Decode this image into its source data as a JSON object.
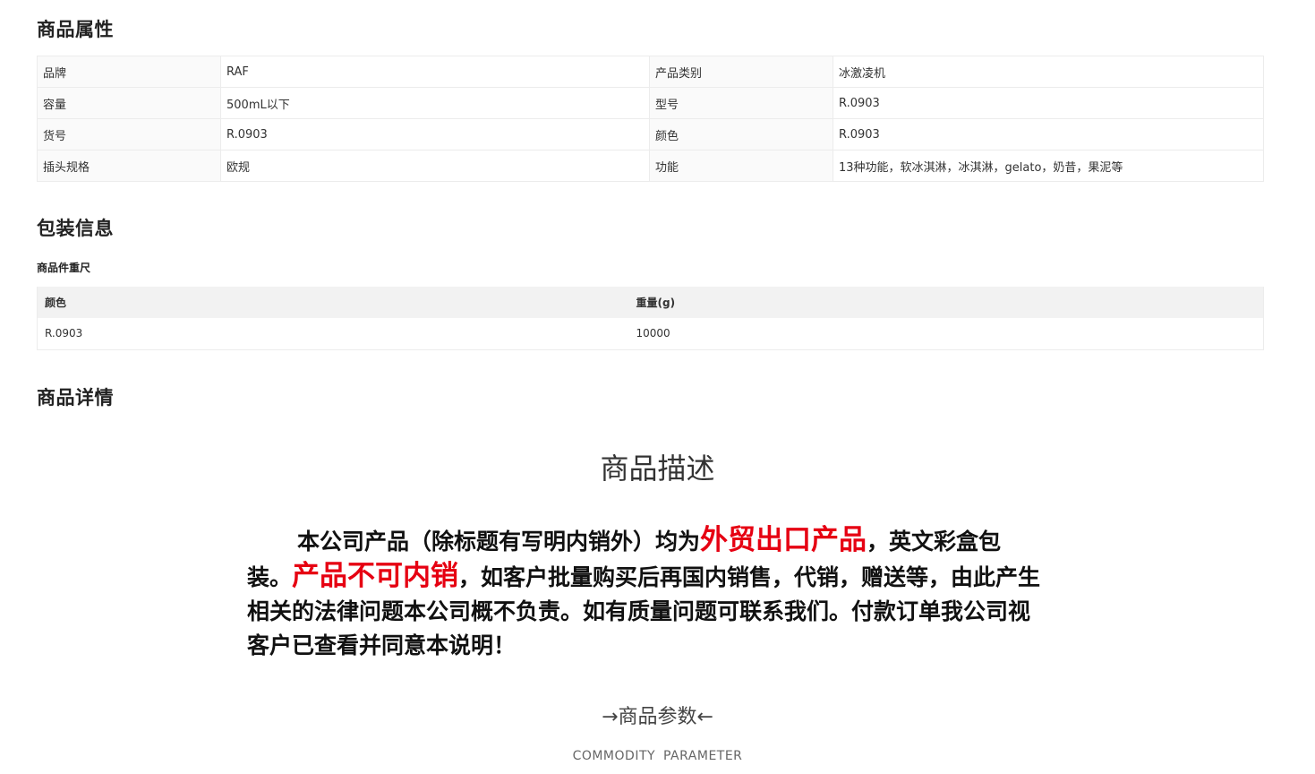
{
  "sections": {
    "attributes_title": "商品属性",
    "packaging_title": "包装信息",
    "details_title": "商品详情"
  },
  "attributes": [
    {
      "k1": "品牌",
      "v1": "RAF",
      "k2": "产品类别",
      "v2": "冰激凌机"
    },
    {
      "k1": "容量",
      "v1": "500mL以下",
      "k2": "型号",
      "v2": "R.0903"
    },
    {
      "k1": "货号",
      "v1": "R.0903",
      "k2": "颜色",
      "v2": "R.0903"
    },
    {
      "k1": "插头规格",
      "v1": "欧规",
      "k2": "功能",
      "v2": "13种功能，软冰淇淋，冰淇淋，gelato，奶昔，果泥等"
    }
  ],
  "packaging": {
    "subtitle": "商品件重尺",
    "headers": [
      "颜色",
      "重量(g)"
    ],
    "rows": [
      [
        "R.0903",
        "10000"
      ]
    ]
  },
  "description": {
    "heading": "商品描述",
    "notice_part1": "本公司产品（除标题有写明内销外）均为",
    "notice_red1": "外贸出口产品",
    "notice_part2": "，英文彩盒包装。",
    "notice_red2": "产品不可内销",
    "notice_part3": "，如客户批量购买后再国内销售，代销，赠送等，由此产生相关的法律问题本公司概不负责。如有质量问题可联系我们。付款订单我公司视客户已查看并同意本说明！"
  },
  "params": {
    "heading": "→商品参数←",
    "subheading": "COMMODITY PARAMETER"
  },
  "colors": {
    "accent_red": "#e60012"
  }
}
